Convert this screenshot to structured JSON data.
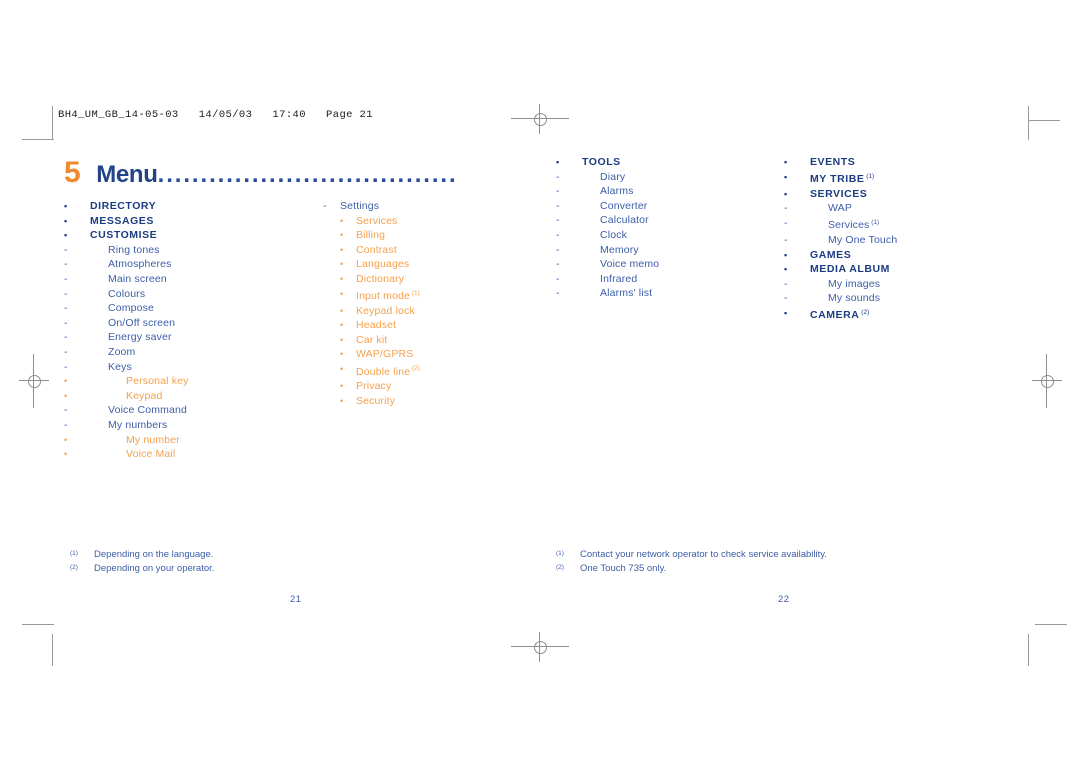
{
  "meta": {
    "slug": "BH4_UM_GB_14-05-03   14/05/03   17:40   Page 21"
  },
  "chapter": {
    "number": "5",
    "title": "Menu",
    "leader": "..................................................",
    "num_color": "#F08A2E",
    "title_color": "#224289"
  },
  "colors": {
    "navy": "#1C3C80",
    "blue": "#3C5EA8",
    "orange": "#F5A14C",
    "orange_dark": "#F08A2E",
    "mark_grey": "#9a9a9a"
  },
  "bullets": {
    "level1": "•",
    "level2": "-",
    "level3": "•"
  },
  "columns": {
    "col1": {
      "items": [
        {
          "level": 1,
          "label": "DIRECTORY"
        },
        {
          "level": 1,
          "label": "MESSAGES"
        },
        {
          "level": 1,
          "label": "CUSTOMISE"
        },
        {
          "level": 2,
          "label": "Ring tones"
        },
        {
          "level": 2,
          "label": "Atmospheres"
        },
        {
          "level": 2,
          "label": "Main screen"
        },
        {
          "level": 2,
          "label": "Colours"
        },
        {
          "level": 2,
          "label": "Compose"
        },
        {
          "level": 2,
          "label": "On/Off screen"
        },
        {
          "level": 2,
          "label": "Energy saver"
        },
        {
          "level": 2,
          "label": "Zoom"
        },
        {
          "level": 2,
          "label": "Keys"
        },
        {
          "level": 3,
          "label": "Personal key"
        },
        {
          "level": 3,
          "label": "Keypad"
        },
        {
          "level": 2,
          "label": "Voice Command"
        },
        {
          "level": 2,
          "label": "My numbers"
        },
        {
          "level": 3,
          "label": "My number"
        },
        {
          "level": 3,
          "label": "Voice Mail"
        }
      ]
    },
    "col2": {
      "items": [
        {
          "level": 2,
          "label": "Settings"
        },
        {
          "level": 3,
          "label": "Services"
        },
        {
          "level": 3,
          "label": "Billing"
        },
        {
          "level": 3,
          "label": "Contrast"
        },
        {
          "level": 3,
          "label": "Languages"
        },
        {
          "level": 3,
          "label": "Dictionary"
        },
        {
          "level": 3,
          "label": "Input mode",
          "footnote": "(1)"
        },
        {
          "level": 3,
          "label": "Keypad lock"
        },
        {
          "level": 3,
          "label": "Headset"
        },
        {
          "level": 3,
          "label": "Car kit"
        },
        {
          "level": 3,
          "label": "WAP/GPRS"
        },
        {
          "level": 3,
          "label": "Double line",
          "footnote": "(2)"
        },
        {
          "level": 3,
          "label": "Privacy"
        },
        {
          "level": 3,
          "label": "Security"
        }
      ]
    },
    "col3": {
      "items": [
        {
          "level": 1,
          "label": "TOOLS"
        },
        {
          "level": 2,
          "label": "Diary"
        },
        {
          "level": 2,
          "label": "Alarms"
        },
        {
          "level": 2,
          "label": "Converter"
        },
        {
          "level": 2,
          "label": "Calculator"
        },
        {
          "level": 2,
          "label": "Clock"
        },
        {
          "level": 2,
          "label": "Memory"
        },
        {
          "level": 2,
          "label": "Voice memo"
        },
        {
          "level": 2,
          "label": "Infrared"
        },
        {
          "level": 2,
          "label": "Alarms' list"
        }
      ]
    },
    "col4": {
      "items": [
        {
          "level": 1,
          "label": "EVENTS"
        },
        {
          "level": 1,
          "label": "MY TRIBE",
          "footnote": "(1)"
        },
        {
          "level": 1,
          "label": "SERVICES"
        },
        {
          "level": 2,
          "label": "WAP"
        },
        {
          "level": 2,
          "label": "Services",
          "footnote": "(1)"
        },
        {
          "level": 2,
          "label": "My One Touch"
        },
        {
          "level": 1,
          "label": "GAMES"
        },
        {
          "level": 1,
          "label": "MEDIA ALBUM"
        },
        {
          "level": 2,
          "label": "My images"
        },
        {
          "level": 2,
          "label": "My sounds"
        },
        {
          "level": 1,
          "label": "CAMERA",
          "footnote": "(2)"
        }
      ]
    }
  },
  "footnotes": {
    "left": [
      {
        "mark": "(1)",
        "text": "Depending on the language."
      },
      {
        "mark": "(2)",
        "text": "Depending on your operator."
      }
    ],
    "right": [
      {
        "mark": "(1)",
        "text": "Contact your network operator to check service availability."
      },
      {
        "mark": "(2)",
        "text": "One Touch 735 only."
      }
    ]
  },
  "folios": {
    "left": "21",
    "right": "22"
  }
}
